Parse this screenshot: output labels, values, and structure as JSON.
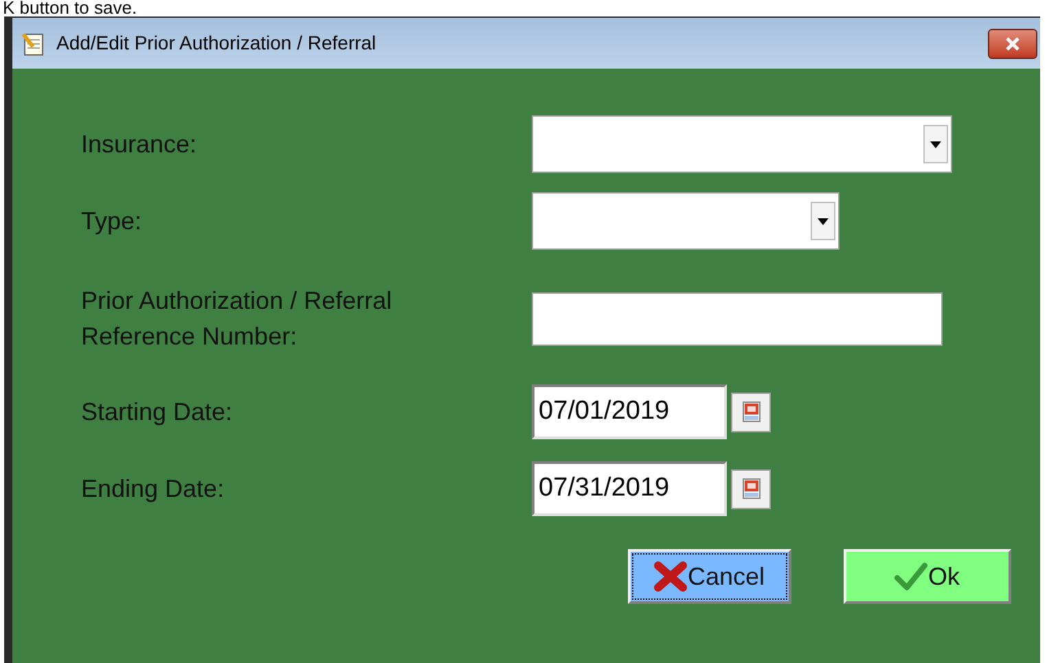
{
  "caption": "K button to save.",
  "window": {
    "title": "Add/Edit Prior Authorization / Referral"
  },
  "fields": [
    {
      "kind": "dropdown",
      "label": "Insurance:"
    },
    {
      "kind": "dropdown",
      "label": "Type:"
    },
    {
      "kind": "text",
      "label": "Prior Authorization / Referral Reference Number:"
    },
    {
      "kind": "date",
      "label": "Starting Date:",
      "value": "07/01/2019"
    },
    {
      "kind": "date",
      "label": "Ending Date:",
      "value": "07/31/2019"
    }
  ],
  "buttons": [
    {
      "kind": "cancel",
      "label": "Cancel",
      "focused": true
    },
    {
      "kind": "ok",
      "label": "Ok",
      "focused": false
    }
  ]
}
